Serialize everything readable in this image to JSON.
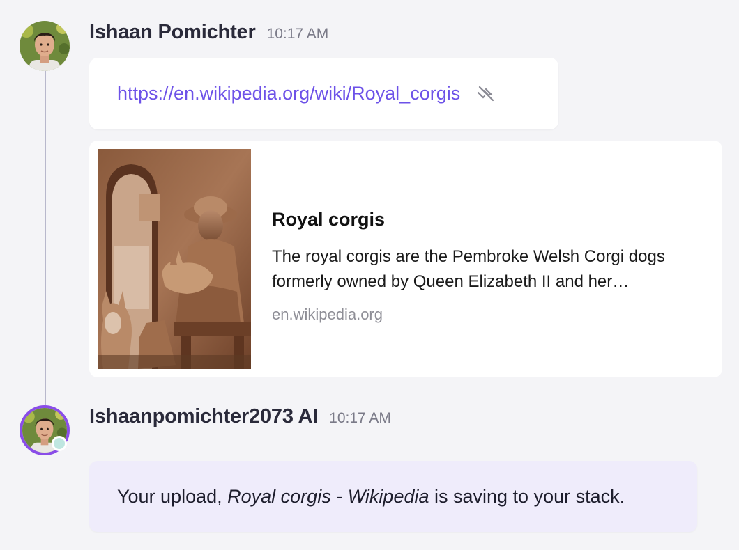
{
  "messages": [
    {
      "author": "Ishaan Pomichter",
      "time": "10:17 AM",
      "avatar_icon": "user-photo-avatar",
      "link": {
        "url": "https://en.wikipedia.org/wiki/Royal_corgis",
        "action_icon": "unlink-icon"
      },
      "preview": {
        "title": "Royal corgis",
        "description": "The royal corgis are the Pembroke Welsh Corgi dogs formerly owned by Queen Elizabeth II and her…",
        "domain": "en.wikipedia.org",
        "image_icon": "statue-thumbnail"
      }
    },
    {
      "author": "Ishaanpomichter2073 AI",
      "time": "10:17 AM",
      "avatar_icon": "ai-user-avatar",
      "status": {
        "prefix": "Your upload, ",
        "item": "Royal corgis - Wikipedia",
        "suffix": " is saving to your stack."
      }
    }
  ],
  "colors": {
    "background": "#f4f4f7",
    "link": "#6d52e8",
    "ai_avatar_ring": "#8a4de8",
    "status_bubble": "#efecfb",
    "presence": "#bfe6e0"
  }
}
